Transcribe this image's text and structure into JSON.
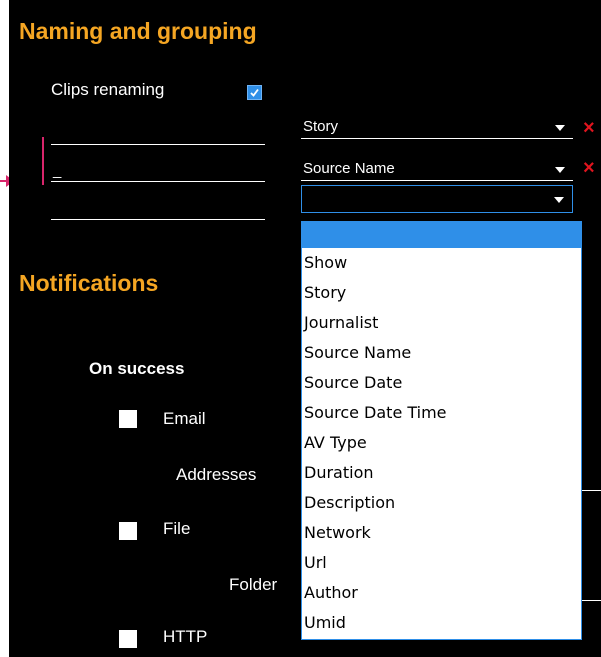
{
  "naming": {
    "title": "Naming and grouping",
    "clips_renaming_label": "Clips renaming",
    "clips_renaming_checked": true,
    "rows": [
      {
        "prefix": "",
        "field": "Story"
      },
      {
        "prefix": "_",
        "field": "Source Name"
      },
      {
        "prefix": "",
        "field": ""
      }
    ]
  },
  "dropdown": {
    "options": [
      "",
      "Show",
      "Story",
      "Journalist",
      "Source Name",
      "Source Date",
      "Source Date Time",
      "AV Type",
      "Duration",
      "Description",
      "Network",
      "Url",
      "Author",
      "Umid"
    ],
    "selected_index": 0
  },
  "notifications": {
    "title": "Notifications",
    "on_success_label": "On success",
    "email_label": "Email",
    "addresses_label": "Addresses",
    "file_label": "File",
    "folder_label": "Folder",
    "http_label": "HTTP"
  },
  "icons": {
    "delete": "×"
  },
  "colors": {
    "accent_orange": "#f5a623",
    "selection_blue": "#2f8fe8",
    "delete_red": "#e0141e",
    "annotation_pink": "#d8256b"
  }
}
